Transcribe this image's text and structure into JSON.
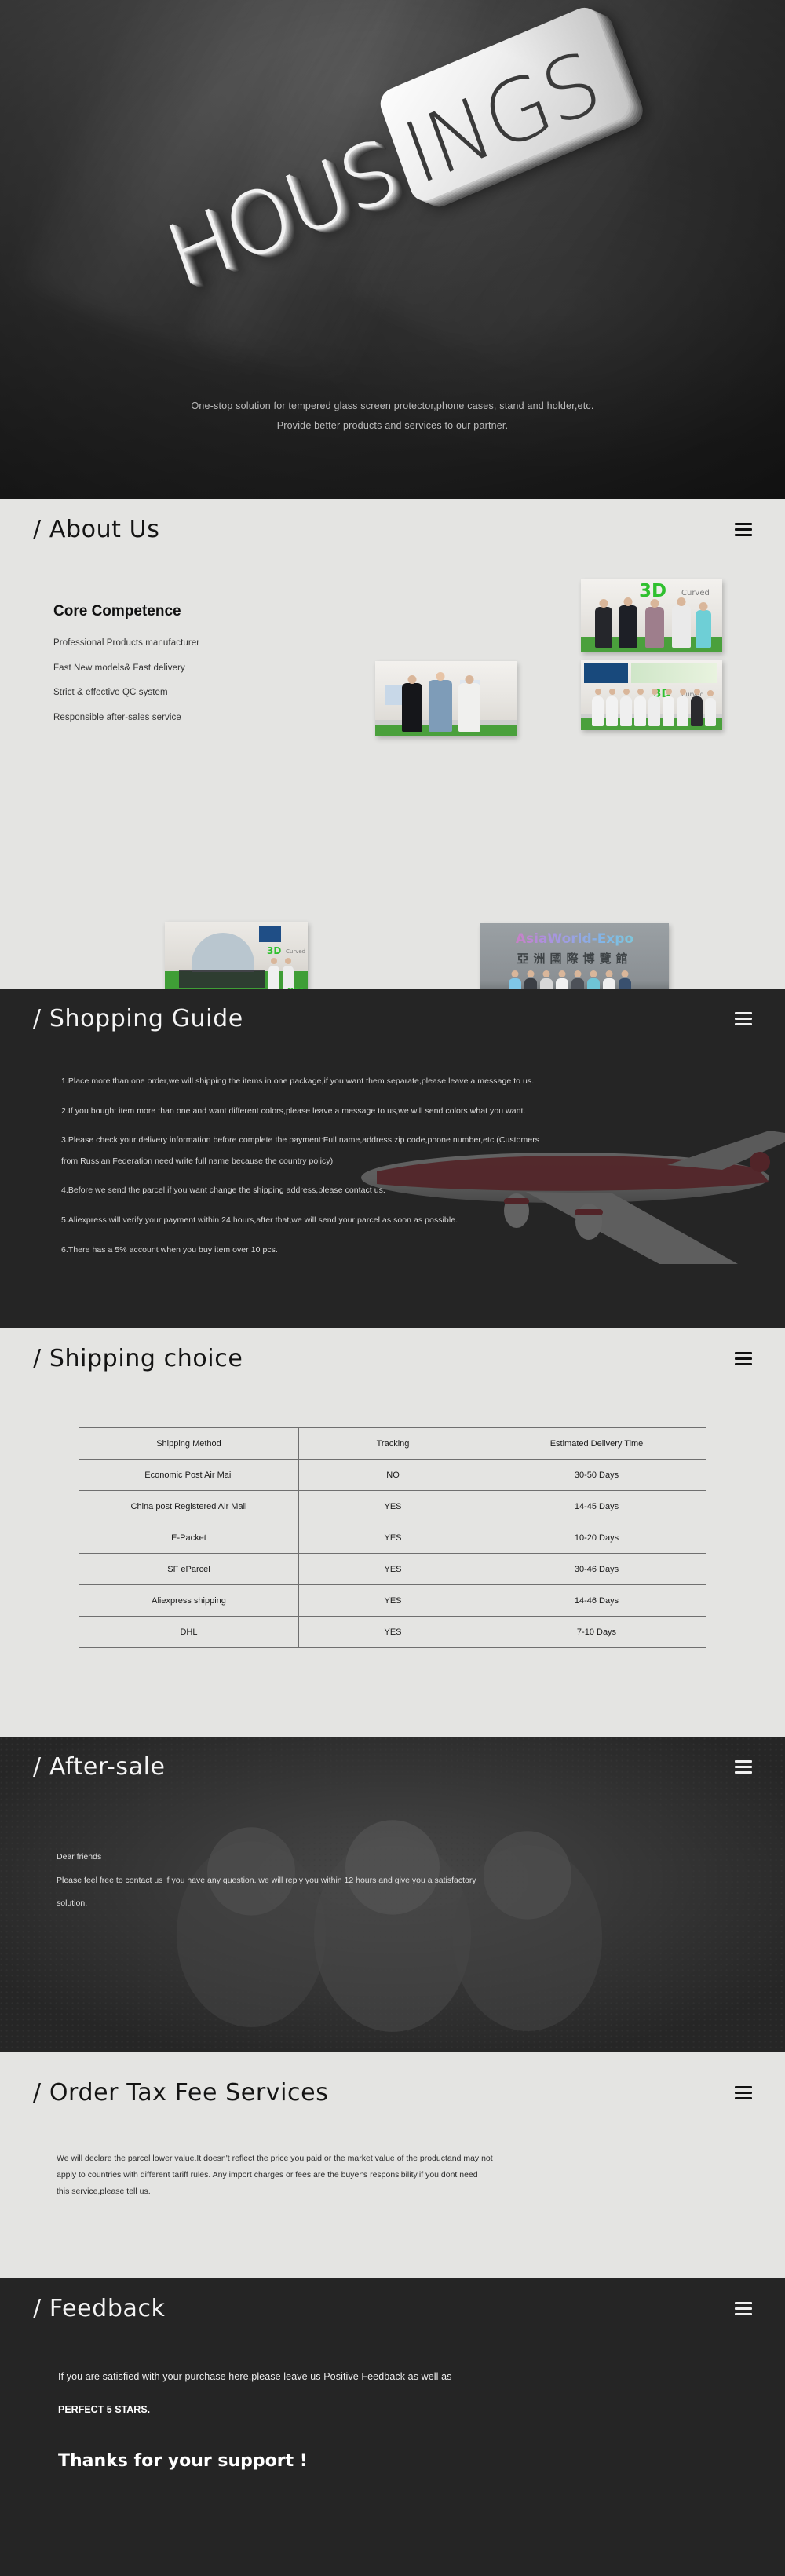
{
  "banner": {
    "logo_front": "HOUS",
    "logo_plate": "INGS",
    "tagline_line1": "One-stop solution for tempered glass screen protector,phone cases, stand and holder,etc.",
    "tagline_line2": "Provide better products and services to our partner."
  },
  "menu_icon": "hamburger-menu-icon",
  "about": {
    "title": "/ About Us",
    "heading": "Core Competence",
    "points": [
      "Professional Products manufacturer",
      "Fast New models& Fast delivery",
      "Strict & effective QC system",
      "Responsible after-sales service"
    ],
    "photos": [
      {
        "name": "photo-3d-curved-booth-visitors",
        "caption_a": "3D",
        "caption_b": "Curved"
      },
      {
        "name": "photo-team-with-customer",
        "caption_a": "",
        "caption_b": ""
      },
      {
        "name": "photo-team-group-booth",
        "caption_a": "3D",
        "caption_b": "Curved"
      },
      {
        "name": "photo-booth-meeting-area",
        "caption_a": "3D",
        "caption_b": "Curved"
      },
      {
        "name": "photo-asiaworld-expo-entrance",
        "caption_a": "AsiaWorld-Expo",
        "caption_b": "亞 洲 國 際 博 覽 館"
      },
      {
        "name": "photo-handshake-award",
        "caption_a": "",
        "caption_b": ""
      }
    ]
  },
  "shopping_guide": {
    "title": "/ Shopping Guide",
    "items": [
      "1.Place more than one order,we will shipping the items in one package,if you want them separate,please leave a message to us.",
      "2.If you bought item more than one and want different colors,please leave a message to us,we will send colors what you want.",
      "3.Please check your delivery information before complete the payment:Full name,address,zip code,phone number,etc.(Customers",
      "from Russian Federation need write full name because the country policy)",
      "4.Before we send the parcel,if you want change the shipping address,please contact us.",
      "5.Aliexpress will verify your payment within 24 hours,after that,we will send your parcel as soon as possible.",
      "6.There has a 5% account when you buy item over 10 pcs."
    ]
  },
  "shipping": {
    "title": "/ Shipping choice",
    "columns": [
      "Shipping Method",
      "Tracking",
      "Estimated Delivery Time"
    ],
    "rows": [
      [
        "Economic Post Air Mail",
        "NO",
        "30-50 Days"
      ],
      [
        "China post Registered Air Mail",
        "YES",
        "14-45 Days"
      ],
      [
        "E-Packet",
        "YES",
        "10-20 Days"
      ],
      [
        "SF eParcel",
        "YES",
        "30-46 Days"
      ],
      [
        "Aliexpress shipping",
        "YES",
        "14-46 Days"
      ],
      [
        "DHL",
        "YES",
        "7-10 Days"
      ]
    ]
  },
  "after_sale": {
    "title": "/ After-sale",
    "greeting": "Dear friends",
    "body_line1": "Please feel free to contact us if you have any question. we will reply you within 12 hours and give you a satisfactory",
    "body_line2": "solution."
  },
  "order_tax": {
    "title": "/ Order Tax Fee Services",
    "line1": "We will declare the parcel lower value.It doesn't reflect the price you paid or the market value of the productand may not",
    "line2": "apply to countries with different tariff rules. Any import charges or fees are the buyer's responsibility.if you dont need",
    "line3": "this service,please tell us."
  },
  "feedback": {
    "title": "/ Feedback",
    "line1": "If you are satisfied with your purchase here,please leave us Positive Feedback as well as",
    "line2": "PERFECT 5 STARS.",
    "line3": "Thanks for your support !"
  },
  "colors": {
    "light_bg": "#e4e4e2",
    "dark_bg": "#252525",
    "banner_bg": "#2e2e2e",
    "accent_green": "#2fc02f"
  }
}
